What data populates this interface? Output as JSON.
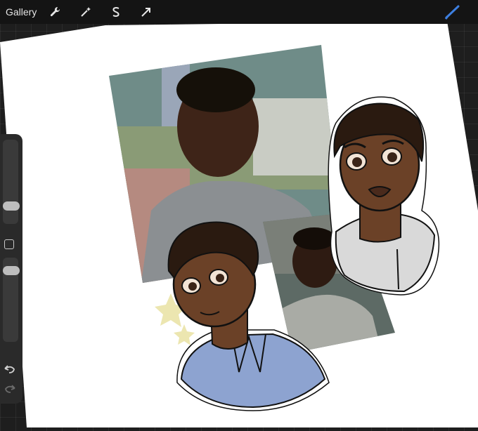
{
  "topbar": {
    "gallery_label": "Gallery",
    "tools": [
      {
        "icon": "wrench-icon"
      },
      {
        "icon": "magic-wand-icon"
      },
      {
        "icon": "selection-s-icon"
      },
      {
        "icon": "transform-arrow-icon"
      }
    ],
    "active_tool": "brush-icon"
  },
  "colors": {
    "topbar": "#141414",
    "canvas_bg": "#1e1e1e",
    "paper": "#ffffff",
    "accent_blue": "#3d7fe0",
    "shirt_blue": "#8da3d0",
    "skin": "#6b4127",
    "hair": "#2a1a10",
    "star": "#ece6b0"
  },
  "sidebar": {
    "brush_size_level": 0.25,
    "opacity_level": 0.9
  }
}
